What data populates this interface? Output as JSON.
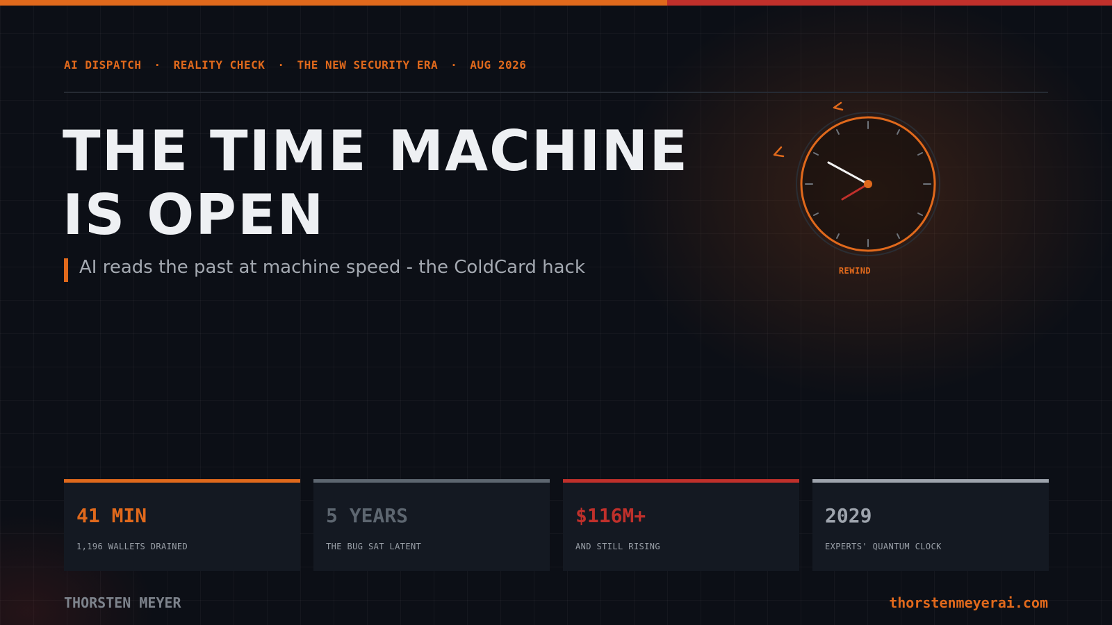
{
  "kicker": {
    "items": [
      "AI DISPATCH",
      "REALITY CHECK",
      "THE NEW SECURITY ERA",
      "AUG 2026"
    ],
    "separator": "·"
  },
  "headline": {
    "line1": "THE TIME MACHINE",
    "line2": "IS OPEN"
  },
  "subline": "AI reads the past at machine speed - the ColdCard hack",
  "clock": {
    "label": "REWIND",
    "icon": "rewind-clock-icon",
    "ring_color": "#e0691c",
    "minute_hand_color": "#f2f2f2",
    "hour_hand_color": "#c0302b"
  },
  "stats": [
    {
      "value": "41 MIN",
      "label": "1,196 WALLETS DRAINED",
      "color": "#e0691c"
    },
    {
      "value": "5 YEARS",
      "label": "THE BUG SAT LATENT",
      "color": "#5d6670"
    },
    {
      "value": "$116M+",
      "label": "AND STILL RISING",
      "color": "#c0302b"
    },
    {
      "value": "2029",
      "label": "EXPERTS' QUANTUM CLOCK",
      "color": "#9ea4ad"
    }
  ],
  "footer": {
    "author": "THORSTEN MEYER",
    "site": "thorstenmeyerai.com"
  },
  "colors": {
    "accent": "#e0691c",
    "danger": "#c0302b",
    "background": "#0c0f16"
  }
}
